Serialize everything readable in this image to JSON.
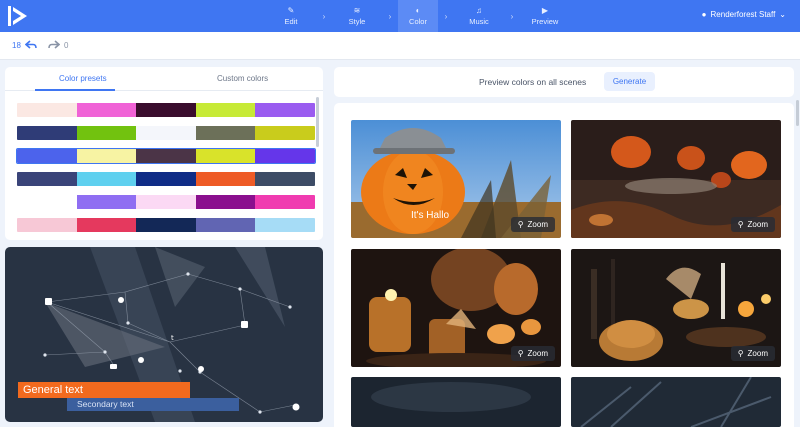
{
  "topbar": {
    "steps": [
      {
        "label": "Edit",
        "icon": "pencil-icon"
      },
      {
        "label": "Style",
        "icon": "layers-icon"
      },
      {
        "label": "Color",
        "icon": "palette-icon"
      },
      {
        "label": "Music",
        "icon": "music-icon"
      },
      {
        "label": "Preview",
        "icon": "play-icon"
      }
    ],
    "active_step": "Color",
    "user": "Renderforest Staff",
    "colors": {
      "bar": "#3f76f2",
      "active": "#5c8bf5"
    }
  },
  "history": {
    "undo_count": "18",
    "redo_count": "0"
  },
  "color_panel": {
    "tabs": [
      "Color presets",
      "Custom colors"
    ],
    "active_tab": "Color presets",
    "presets": [
      [
        "#fbe8e3",
        "#f062d6",
        "#3a0d2d",
        "#c7ea36",
        "#9a5cf0"
      ],
      [
        "#2f3c77",
        "#72c20f",
        "#f4f6fb",
        "#6c7059",
        "#c9cc1c"
      ],
      [
        "#4c63ec",
        "#f7f3a3",
        "#4b3447",
        "#d9e32a",
        "#6536ea"
      ],
      [
        "#3a4479",
        "#5fd0ef",
        "#0f2c87",
        "#ee5b26",
        "#3d4c66"
      ],
      [
        "#ffffff",
        "#8f6ef2",
        "#fbd9f4",
        "#8a0f8e",
        "#f03bb0"
      ],
      [
        "#f7c8d6",
        "#e5395e",
        "#132857",
        "#6165b3",
        "#a6dcf6"
      ]
    ]
  },
  "text_preview": {
    "general": "General text",
    "secondary": "Secondary text"
  },
  "preview_bar": {
    "label": "Preview colors on all scenes",
    "button": "Generate"
  },
  "scenes": [
    {
      "caption": "It's Hallo",
      "zoom": "Zoom"
    },
    {
      "caption": "",
      "zoom": "Zoom"
    },
    {
      "caption": "",
      "zoom": "Zoom"
    },
    {
      "caption": "",
      "zoom": "Zoom"
    }
  ]
}
